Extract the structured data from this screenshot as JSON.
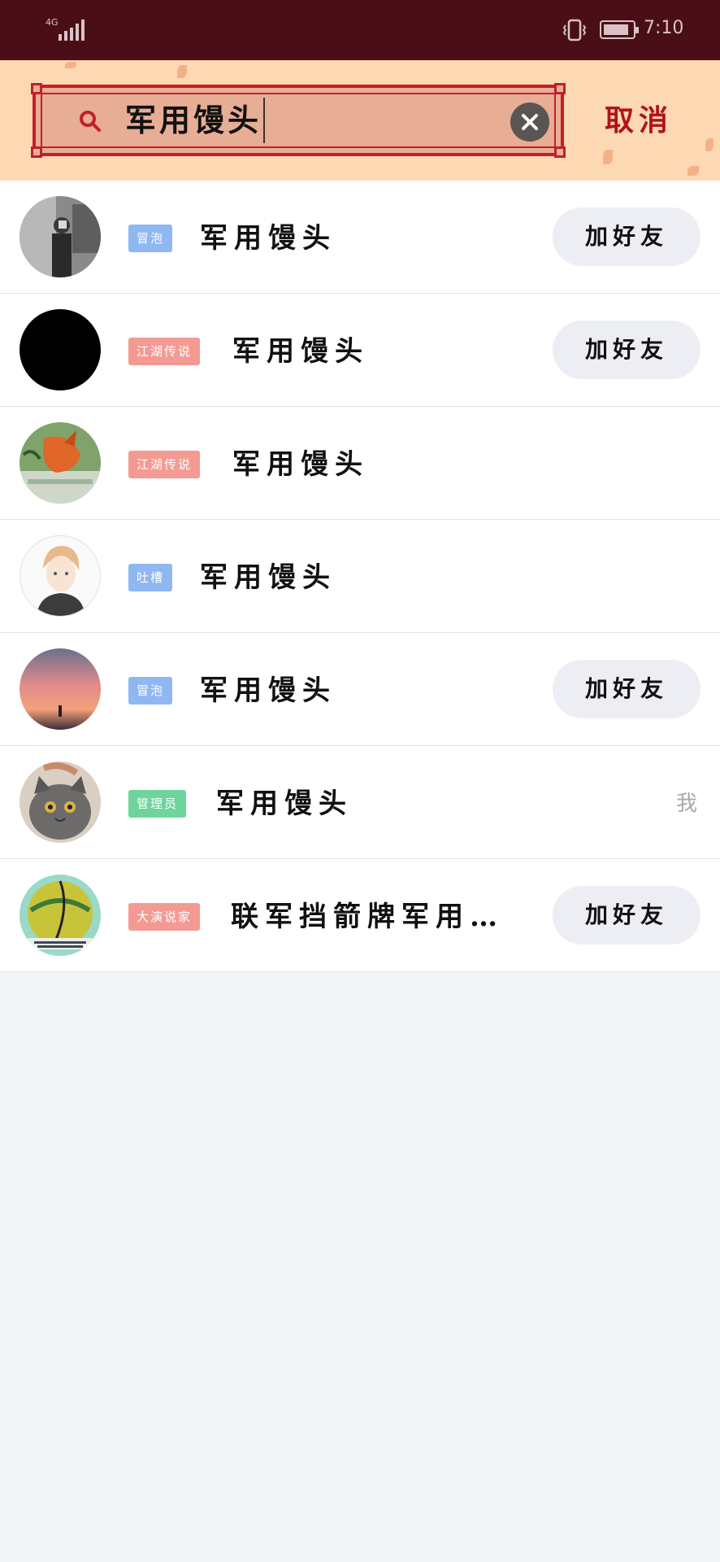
{
  "status_bar": {
    "network": "4G",
    "time": "7:10"
  },
  "search": {
    "query": "军用馒头",
    "cancel_label": "取消"
  },
  "results": [
    {
      "badge": "冒泡",
      "badge_color": "#8fb7f2",
      "name": "军用馒头",
      "action": "加好友",
      "avatar": "photo-person-bw"
    },
    {
      "badge": "江湖传说",
      "badge_color": "#f49a93",
      "name": "军用馒头",
      "action": "加好友",
      "avatar": "black-circle"
    },
    {
      "badge": "江湖传说",
      "badge_color": "#f49a93",
      "name": "军用馒头",
      "action": "",
      "avatar": "fox-painting"
    },
    {
      "badge": "吐槽",
      "badge_color": "#8fb7f2",
      "name": "军用馒头",
      "action": "",
      "avatar": "anime-boy"
    },
    {
      "badge": "冒泡",
      "badge_color": "#8fb7f2",
      "name": "军用馒头",
      "action": "加好友",
      "avatar": "sunset-sky"
    },
    {
      "badge": "管理员",
      "badge_color": "#6fd49c",
      "name": "军用馒头",
      "action": "",
      "me_label": "我",
      "avatar": "cat-photo"
    },
    {
      "badge": "大演说家",
      "badge_color": "#f49a93",
      "name": "联军挡箭牌军用…",
      "action": "加好友",
      "avatar": "green-ball"
    }
  ]
}
